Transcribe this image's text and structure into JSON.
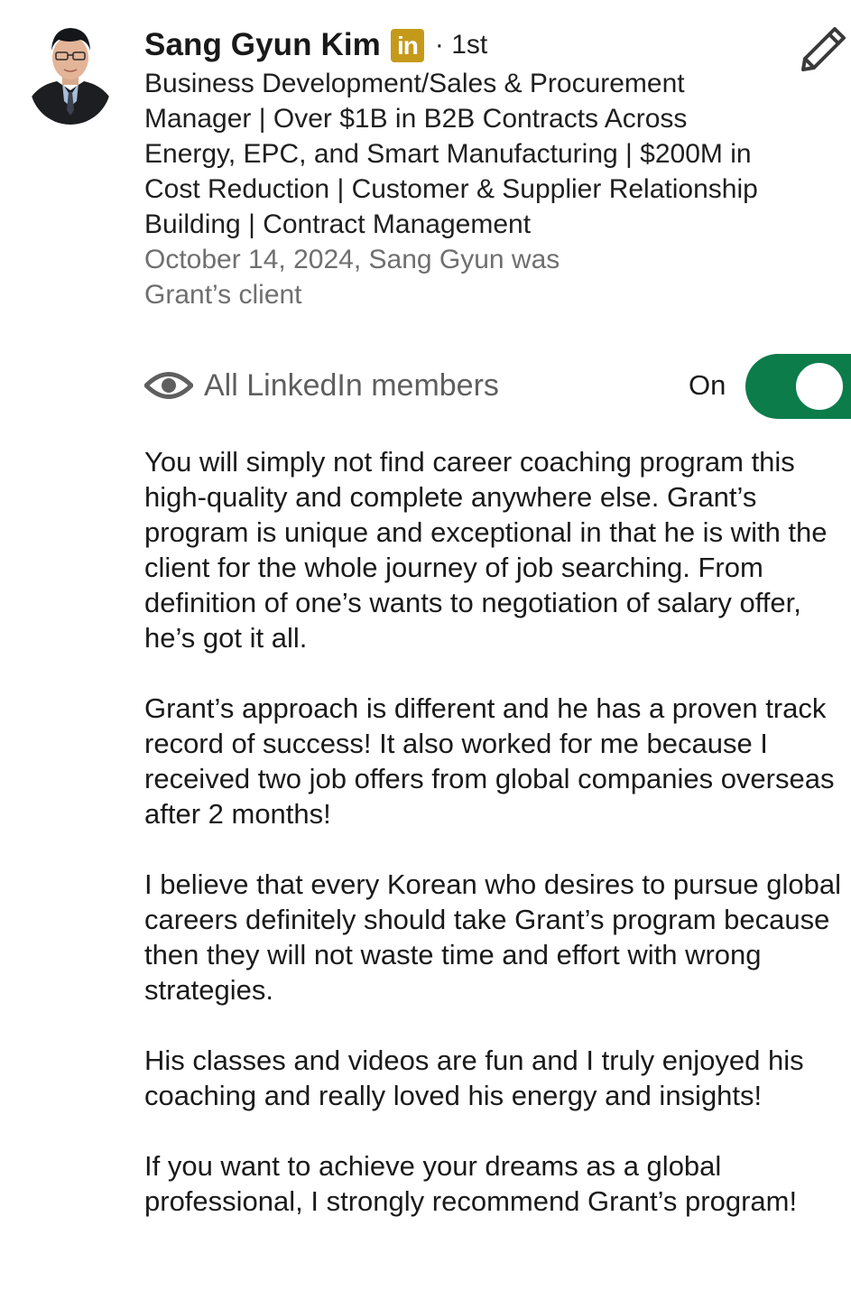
{
  "profile": {
    "name": "Sang Gyun Kim",
    "badge_text": "in",
    "degree": "· 1st",
    "headline": "Business Development/Sales & Procurement Manager | Over $1B in B2B Contracts Across Energy, EPC, and Smart Manufacturing | $200M in Cost Reduction | Customer & Supplier Relationship Building | Contract Management",
    "meta": "October 14, 2024, Sang Gyun was Grant’s client"
  },
  "visibility": {
    "icon": "eye-icon",
    "label": "All LinkedIn members",
    "toggle_state_label": "On",
    "toggle_on": true
  },
  "recommendation": {
    "paragraphs": [
      "You will simply not find career coaching program this high-quality and complete anywhere else. Grant’s program is unique and exceptional in that he is with the client for the whole journey of job searching. From definition of one’s wants to negotiation of salary offer, he’s got it all.",
      "Grant’s approach is different and he has a proven track record of success! It also worked for me because I received two job offers from global companies overseas after 2 months!",
      "I believe that every Korean who desires to pursue global careers definitely should take Grant’s program because then they will not waste time and effort with wrong strategies.",
      "His classes and videos are fun and I truly enjoyed his coaching and really loved his energy and insights!",
      "If you want to achieve your dreams as a global professional, I strongly recommend Grant’s program!"
    ]
  },
  "colors": {
    "toggle_on": "#0b7c4a",
    "badge": "#c59a1b",
    "meta_text": "#6f6f6f"
  }
}
